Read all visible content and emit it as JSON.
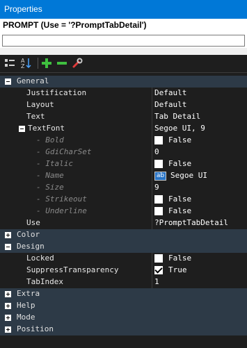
{
  "window": {
    "title": "Properties"
  },
  "object": {
    "name": "PROMPT (Use = '?PromptTabDetail')",
    "filter_value": ""
  },
  "toolbar": {
    "icons": [
      "categorized-icon",
      "alphabetical-sort-icon",
      "add-icon",
      "remove-icon",
      "wrench-icon"
    ]
  },
  "categories": {
    "general": "General",
    "color": "Color",
    "design": "Design",
    "extra": "Extra",
    "help": "Help",
    "mode": "Mode",
    "position": "Position"
  },
  "props": {
    "justification": {
      "name": "Justification",
      "value": "Default"
    },
    "layout": {
      "name": "Layout",
      "value": "Default"
    },
    "text": {
      "name": "Text",
      "value": "Tab Detail"
    },
    "textfont": {
      "name": "TextFont",
      "value": "Segoe UI, 9"
    },
    "bold": {
      "name": "- Bold",
      "value": "False",
      "checked": false
    },
    "gdicharset": {
      "name": "- GdiCharSet",
      "value": "0"
    },
    "italic": {
      "name": "- Italic",
      "value": "False",
      "checked": false
    },
    "fontname": {
      "name": "- Name",
      "value": "Segoe UI",
      "icon_text": "ab"
    },
    "size": {
      "name": "- Size",
      "value": "9"
    },
    "strikeout": {
      "name": "- Strikeout",
      "value": "False",
      "checked": false
    },
    "underline": {
      "name": "- Underline",
      "value": "False",
      "checked": false
    },
    "use": {
      "name": "Use",
      "value": "?PromptTabDetail"
    },
    "locked": {
      "name": "Locked",
      "value": "False",
      "checked": false
    },
    "suppress": {
      "name": "SuppressTransparency",
      "value": "True",
      "checked": true
    },
    "tabindex": {
      "name": "TabIndex",
      "value": "1"
    }
  },
  "colors": {
    "titlebar": "#0078d7",
    "grid_bg": "#1e1e1e",
    "category_bg": "#2d3a47",
    "add": "#3fbf3f",
    "remove": "#3fbf3f",
    "wrench": "#e03a3a"
  }
}
